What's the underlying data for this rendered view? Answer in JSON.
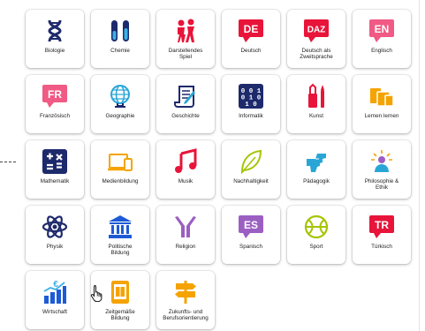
{
  "tiles": [
    {
      "label": "Biologie",
      "icon": "dna-icon"
    },
    {
      "label": "Chemie",
      "icon": "test-tubes-icon"
    },
    {
      "label": "Darstellendes\nSpiel",
      "icon": "performers-icon"
    },
    {
      "label": "Deutsch",
      "icon": "de-badge-icon",
      "badge": "DE",
      "color": "#e8143a"
    },
    {
      "label": "Deutsch als\nZweitsprache",
      "icon": "daz-badge-icon",
      "badge": "DAZ",
      "color": "#e8143a"
    },
    {
      "label": "Englisch",
      "icon": "en-badge-icon",
      "badge": "EN",
      "color": "#f05a84"
    },
    {
      "label": "Französisch",
      "icon": "fr-badge-icon",
      "badge": "FR",
      "color": "#f05a84"
    },
    {
      "label": "Geographie",
      "icon": "globe-icon"
    },
    {
      "label": "Geschichte",
      "icon": "scroll-icon"
    },
    {
      "label": "Informatik",
      "icon": "binary-icon"
    },
    {
      "label": "Kunst",
      "icon": "paint-tools-icon"
    },
    {
      "label": "Lernen lernen",
      "icon": "books-icon"
    },
    {
      "label": "Mathematik",
      "icon": "calculator-icon"
    },
    {
      "label": "Medienbildung",
      "icon": "devices-icon"
    },
    {
      "label": "Musik",
      "icon": "music-note-icon"
    },
    {
      "label": "Nachhaltigkeit",
      "icon": "leaf-icon"
    },
    {
      "label": "Pädagogik",
      "icon": "hand-icon"
    },
    {
      "label": "Philosophie &\nEthik",
      "icon": "thinker-icon"
    },
    {
      "label": "Physik",
      "icon": "atom-icon"
    },
    {
      "label": "Politische\nBildung",
      "icon": "institution-icon"
    },
    {
      "label": "Religion",
      "icon": "praying-hands-icon"
    },
    {
      "label": "Spanisch",
      "icon": "es-badge-icon",
      "badge": "ES",
      "color": "#9b5fc2"
    },
    {
      "label": "Sport",
      "icon": "ball-icon"
    },
    {
      "label": "Türkisch",
      "icon": "tr-badge-icon",
      "badge": "TR",
      "color": "#e8143a"
    },
    {
      "label": "Wirtschaft",
      "icon": "economy-chart-icon"
    },
    {
      "label": "Zeitgemäße\nBildung",
      "icon": "tablet-book-icon"
    },
    {
      "label": "Zukunfts- und\nBerufsorientierung",
      "icon": "signpost-icon"
    }
  ]
}
